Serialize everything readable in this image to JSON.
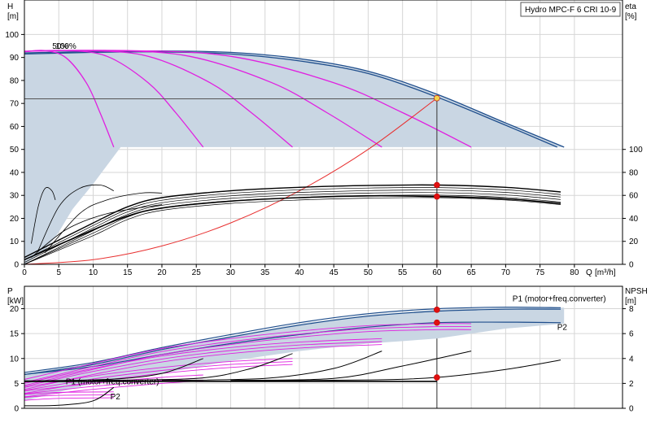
{
  "title_box": "Hydro MPC-F 6 CRI 10-9",
  "colors": {
    "envelope_fill": "#c9d6e3",
    "envelope_edge": "#1f4e8c",
    "magenta": "#e020e0",
    "black": "#000000",
    "system": "#e83030",
    "duty_point": "#e01010",
    "duty_highlight": "#f2d24a",
    "grid": "#d6d6d6"
  },
  "chart_data": [
    {
      "type": "line",
      "panel": "head",
      "ylabel_left": "H",
      "yunit_left": "[m]",
      "ylabel_right": "eta",
      "yunit_right": "[%]",
      "xlabel": "Q",
      "xunit": "[m³/h]",
      "xlim": [
        0,
        87
      ],
      "xticks": [
        0,
        5,
        10,
        15,
        20,
        25,
        30,
        35,
        40,
        45,
        50,
        55,
        60,
        65,
        70,
        75,
        80
      ],
      "ylim": [
        0,
        115
      ],
      "yticks": [
        0,
        10,
        20,
        30,
        40,
        50,
        60,
        70,
        80,
        90,
        100
      ],
      "eta_ticks": [
        0,
        20,
        40,
        60,
        80,
        100
      ],
      "eta_map": {
        "zero_at_h": 0,
        "hundred_at_h": 50
      },
      "annotation": "50%",
      "annotation_overlap": "100%",
      "annotation_pos": [
        5,
        93
      ],
      "envelope": [
        [
          0,
          92
        ],
        [
          10,
          92.6
        ],
        [
          20,
          92.8
        ],
        [
          30,
          92.2
        ],
        [
          40,
          89.5
        ],
        [
          50,
          84
        ],
        [
          60,
          74
        ],
        [
          70,
          61.5
        ],
        [
          78.5,
          51
        ],
        [
          14,
          51
        ],
        [
          10,
          35
        ],
        [
          7,
          24
        ],
        [
          5,
          14
        ],
        [
          3,
          6
        ],
        [
          1,
          2
        ],
        [
          0,
          0
        ]
      ],
      "envelope_edges": [
        [
          [
            0,
            92
          ],
          [
            10,
            92.6
          ],
          [
            20,
            92.8
          ],
          [
            30,
            92.2
          ],
          [
            40,
            89.5
          ],
          [
            50,
            84
          ],
          [
            60,
            74
          ],
          [
            70,
            61.5
          ],
          [
            78.5,
            51
          ]
        ],
        [
          [
            0,
            91.5
          ],
          [
            10,
            92.2
          ],
          [
            20,
            92.4
          ],
          [
            30,
            91.5
          ],
          [
            40,
            88.5
          ],
          [
            50,
            83
          ],
          [
            60,
            72.8
          ],
          [
            70,
            60.5
          ],
          [
            77.5,
            51
          ]
        ]
      ],
      "speed_curves": [
        [
          [
            0,
            92.5
          ],
          [
            3,
            93
          ],
          [
            6,
            90
          ],
          [
            9,
            79
          ],
          [
            11,
            66
          ],
          [
            13,
            51
          ]
        ],
        [
          [
            0,
            92.6
          ],
          [
            6,
            93
          ],
          [
            12,
            90.5
          ],
          [
            18,
            79
          ],
          [
            22,
            66
          ],
          [
            26,
            51
          ]
        ],
        [
          [
            0,
            92.7
          ],
          [
            9,
            93
          ],
          [
            18,
            90.5
          ],
          [
            27,
            79
          ],
          [
            33,
            66
          ],
          [
            39,
            51
          ]
        ],
        [
          [
            0,
            92.7
          ],
          [
            12,
            93
          ],
          [
            24,
            90.5
          ],
          [
            36,
            79
          ],
          [
            44,
            66
          ],
          [
            52,
            51
          ]
        ],
        [
          [
            0,
            92.7
          ],
          [
            15,
            93
          ],
          [
            30,
            90.5
          ],
          [
            45,
            79
          ],
          [
            55,
            66
          ],
          [
            65,
            51
          ]
        ]
      ],
      "horizontal_line_y": 72,
      "duty_x": 60,
      "duty_points": [
        [
          60,
          72.3,
          "duty_highlight"
        ],
        [
          60,
          34.5,
          "duty_point"
        ],
        [
          60,
          29.5,
          "duty_point"
        ]
      ],
      "system_curve": [
        [
          0,
          0
        ],
        [
          10,
          2
        ],
        [
          20,
          8
        ],
        [
          30,
          18
        ],
        [
          40,
          32
        ],
        [
          50,
          50
        ],
        [
          60,
          72.3
        ]
      ],
      "black_upper": [
        [
          0,
          3
        ],
        [
          10,
          18
        ],
        [
          15,
          25
        ],
        [
          20,
          29
        ],
        [
          30,
          32
        ],
        [
          40,
          33.5
        ],
        [
          50,
          34.3
        ],
        [
          60,
          34.5
        ],
        [
          70,
          33.5
        ],
        [
          78,
          31.5
        ]
      ],
      "black_lower": [
        [
          0,
          2
        ],
        [
          10,
          15
        ],
        [
          15,
          21
        ],
        [
          20,
          24.5
        ],
        [
          30,
          27.5
        ],
        [
          40,
          29
        ],
        [
          50,
          29.8
        ],
        [
          60,
          29.5
        ],
        [
          70,
          28.5
        ],
        [
          78,
          26.5
        ]
      ],
      "small_loops": [
        [
          [
            1,
            9
          ],
          [
            2,
            25
          ],
          [
            3,
            33
          ],
          [
            4,
            32
          ],
          [
            4.5,
            28
          ]
        ],
        [
          [
            2,
            6
          ],
          [
            5,
            25
          ],
          [
            8,
            33
          ],
          [
            11,
            34.5
          ],
          [
            13,
            32
          ]
        ],
        [
          [
            3,
            5
          ],
          [
            8,
            22
          ],
          [
            12,
            28
          ],
          [
            17,
            31
          ],
          [
            20,
            31
          ]
        ],
        [
          [
            1,
            3
          ],
          [
            6,
            15
          ],
          [
            12,
            22
          ],
          [
            20,
            26
          ]
        ]
      ]
    },
    {
      "type": "line",
      "panel": "power",
      "ylabel_left": "P",
      "yunit_left": "[kW]",
      "ylabel_right": "NPSH",
      "yunit_right": "[m]",
      "xlim": [
        0,
        87
      ],
      "ylim": [
        0,
        24.5
      ],
      "yticks": [
        0,
        5,
        10,
        15,
        20
      ],
      "npsh_ticks": [
        0,
        2,
        4,
        6,
        8
      ],
      "npsh_map": {
        "zero_at_p": 0,
        "eight_at_p": 20
      },
      "envelope": [
        [
          0,
          7
        ],
        [
          10,
          9
        ],
        [
          20,
          12
        ],
        [
          30,
          14.5
        ],
        [
          40,
          17
        ],
        [
          50,
          18.8
        ],
        [
          60,
          19.8
        ],
        [
          70,
          20.2
        ],
        [
          78.5,
          20.2
        ],
        [
          78.5,
          17
        ],
        [
          70,
          16
        ],
        [
          60,
          14
        ],
        [
          50,
          13
        ],
        [
          40,
          11.5
        ],
        [
          30,
          9.5
        ],
        [
          20,
          7
        ],
        [
          10,
          5
        ],
        [
          0,
          1.5
        ]
      ],
      "envelope_edges": [
        [
          [
            0,
            7.2
          ],
          [
            10,
            9.2
          ],
          [
            20,
            12.2
          ],
          [
            30,
            14.8
          ],
          [
            40,
            17.2
          ],
          [
            50,
            19
          ],
          [
            60,
            20
          ],
          [
            70,
            20.3
          ],
          [
            78,
            20.2
          ]
        ],
        [
          [
            0,
            6.8
          ],
          [
            10,
            8.8
          ],
          [
            20,
            11.8
          ],
          [
            30,
            14.3
          ],
          [
            40,
            16.7
          ],
          [
            50,
            18.5
          ],
          [
            60,
            19.5
          ],
          [
            70,
            19.9
          ],
          [
            78,
            19.9
          ]
        ],
        [
          [
            0,
            6.8
          ],
          [
            10,
            8.4
          ],
          [
            20,
            10.8
          ],
          [
            30,
            13
          ],
          [
            40,
            14.8
          ],
          [
            50,
            16.3
          ],
          [
            60,
            17.2
          ],
          [
            70,
            17.3
          ],
          [
            78,
            17.2
          ]
        ]
      ],
      "magenta_curves": [
        [
          [
            0,
            2.8
          ],
          [
            5,
            3.2
          ],
          [
            13,
            3.3
          ]
        ],
        [
          [
            0,
            3.5
          ],
          [
            10,
            5
          ],
          [
            20,
            6.2
          ],
          [
            26,
            6.7
          ]
        ],
        [
          [
            0,
            4.2
          ],
          [
            10,
            6.5
          ],
          [
            20,
            8.2
          ],
          [
            30,
            9.4
          ],
          [
            39,
            10
          ]
        ],
        [
          [
            0,
            5
          ],
          [
            10,
            8
          ],
          [
            20,
            10.5
          ],
          [
            30,
            12.2
          ],
          [
            40,
            13.3
          ],
          [
            52,
            14
          ]
        ],
        [
          [
            0,
            5.8
          ],
          [
            10,
            9
          ],
          [
            20,
            12
          ],
          [
            30,
            14
          ],
          [
            40,
            15.5
          ],
          [
            50,
            16.6
          ],
          [
            60,
            17
          ],
          [
            65,
            17
          ]
        ]
      ],
      "npsh_curves": [
        [
          [
            0,
            0.5
          ],
          [
            5,
            0.6
          ],
          [
            10,
            1.5
          ],
          [
            13,
            4.2
          ]
        ],
        [
          [
            0,
            5.5
          ],
          [
            12,
            5.8
          ],
          [
            20,
            7
          ],
          [
            26,
            10
          ]
        ],
        [
          [
            10,
            5.6
          ],
          [
            25,
            6
          ],
          [
            33,
            8
          ],
          [
            39,
            11
          ]
        ],
        [
          [
            20,
            5.6
          ],
          [
            35,
            6
          ],
          [
            45,
            8
          ],
          [
            52,
            11.5
          ]
        ],
        [
          [
            30,
            5.6
          ],
          [
            45,
            6
          ],
          [
            55,
            8.5
          ],
          [
            65,
            11.5
          ]
        ],
        [
          [
            30,
            5.5
          ],
          [
            50,
            5.7
          ],
          [
            60,
            6.2
          ],
          [
            70,
            7.8
          ],
          [
            78,
            9.7
          ]
        ]
      ],
      "duty_points": [
        [
          60,
          19.8
        ],
        [
          60,
          17.2
        ],
        [
          60,
          6.2
        ]
      ],
      "labels": [
        {
          "text": "P1 (motor+freq.converter)",
          "x": 71,
          "y": 21.5,
          "dark": true
        },
        {
          "text": "P2",
          "x": 77.5,
          "y": 15.8,
          "dark": true
        },
        {
          "text": "P1 (motor+freq.converter)",
          "x": 6,
          "y": 4.8,
          "dark": false
        },
        {
          "text": "P2",
          "x": 12.5,
          "y": 1.8,
          "dark": false
        }
      ]
    }
  ]
}
